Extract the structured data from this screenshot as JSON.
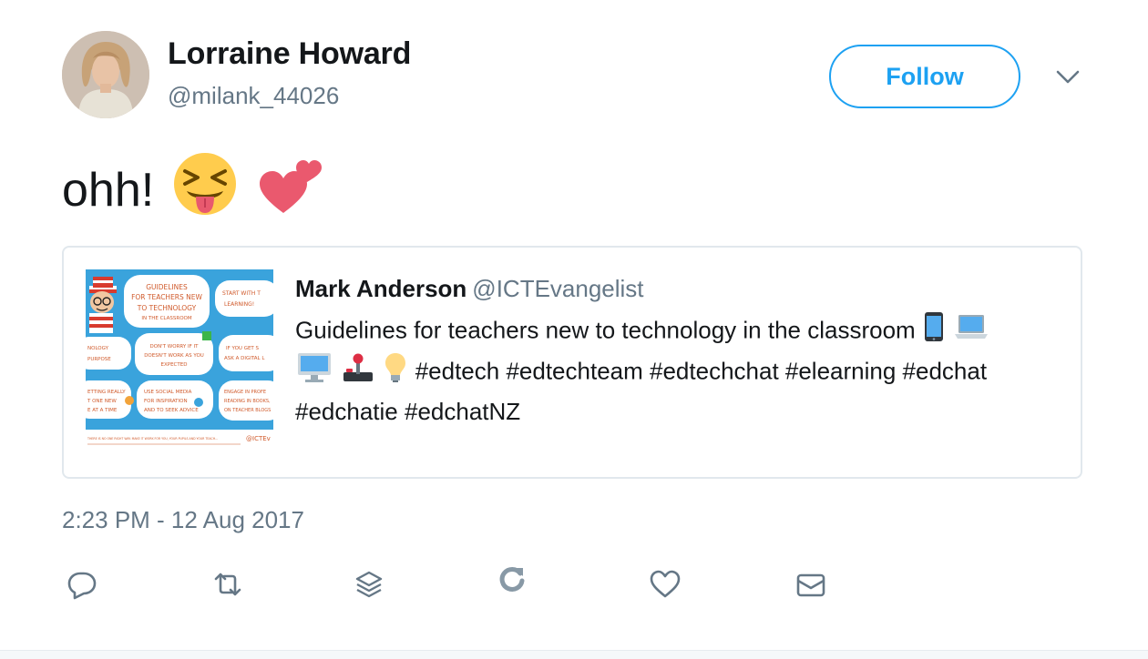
{
  "user": {
    "name": "Lorraine Howard",
    "handle": "@milank_44026",
    "avatar_icon": "profile-photo"
  },
  "follow_label": "Follow",
  "menu_icon": "chevron-down-icon",
  "tweet": {
    "text": "ohh!",
    "emojis": [
      "squinting-tongue-face",
      "two-hearts"
    ]
  },
  "quoted": {
    "name": "Mark Anderson",
    "handle": "@ICTEvangelist",
    "text_before_icons": "Guidelines for teachers new to technology in the classroom",
    "icons": [
      "mobile-phone",
      "laptop",
      "desktop-computer",
      "joystick",
      "light-bulb"
    ],
    "hashtags_line": "#edtech #edtechteam #edtechchat #elearning #edchat",
    "hashtags_line2": "#edchatie #edchatNZ",
    "thumbnail": {
      "title_lines": [
        "GUIDELINES",
        "FOR TEACHERS NEW",
        "TO TECHNOLOGY",
        "IN THE CLASSROOM"
      ],
      "box_start": [
        "START WITH T",
        "LEARNING!"
      ],
      "box_mid1": [
        "DON'T WORRY IF IT",
        "DOESN'T WORK AS YOU",
        "EXPECTED"
      ],
      "box_right1": [
        "IF YOU GET S",
        "ASK A DIGITAL L"
      ],
      "box_left1": [
        "NOLOGY",
        "PURPOSE"
      ],
      "box_left2": [
        "ETTING REALLY",
        "T ONE NEW",
        "E AT A TIME"
      ],
      "box_mid2": [
        "USE SOCIAL MEDIA",
        "FOR INSPIRATION",
        "AND TO SEEK ADVICE"
      ],
      "box_right2": [
        "ENGAGE IN PROFE",
        "READING IN BOOKS,",
        "ON TEACHER BLOGS"
      ],
      "footer": "THERE IS NO ONE RIGHT WAY. MAKE IT WORK FOR YOU, YOUR PUPILS AND YOUR TEACH...",
      "footer_handle": "@ICTEv"
    }
  },
  "timestamp": "2:23 PM - 12 Aug 2017",
  "actions": [
    "reply-icon",
    "retweet-icon",
    "layers-icon",
    "refresh-icon",
    "like-icon",
    "direct-message-icon"
  ],
  "colors": {
    "accent": "#1da1f2",
    "secondary_text": "#657786",
    "border": "#e1e8ed",
    "action_icon": "#657786"
  }
}
